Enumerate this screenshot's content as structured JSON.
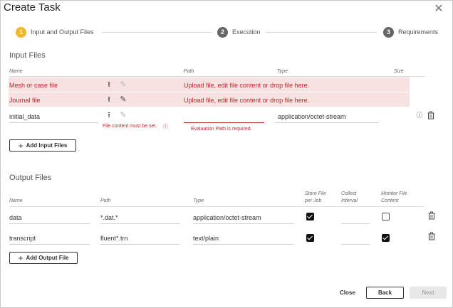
{
  "dialog": {
    "title": "Create Task"
  },
  "steps": [
    {
      "number": "1",
      "label": "Input and Output Files",
      "color": "#f5b52a"
    },
    {
      "number": "2",
      "label": "Execution",
      "color": "#666666"
    },
    {
      "number": "3",
      "label": "Requirements",
      "color": "#666666"
    }
  ],
  "input_files": {
    "section_title": "Input Files",
    "columns": {
      "name": "Name",
      "path": "Path",
      "type": "Type",
      "size": "Size"
    },
    "rows": [
      {
        "name": "Mesh or case file",
        "message": "Upload file, edit file content or drop file here."
      },
      {
        "name": "Journal file",
        "message": "Upload file, edit file content or drop file here."
      },
      {
        "name": "initial_data",
        "path_value": "",
        "type_value": "application/octet-stream",
        "content_error": "File content must be set.",
        "path_error": "Evaluation Path is required."
      }
    ],
    "add_button": "Add Input Files"
  },
  "output_files": {
    "section_title": "Output Files",
    "columns": {
      "name": "Name",
      "path": "Path",
      "type": "Type",
      "store_line1": "Store File",
      "store_line2": "per Job",
      "collect_line1": "Collect",
      "collect_line2": "Interval",
      "monitor_line1": "Monitor File",
      "monitor_line2": "Content"
    },
    "rows": [
      {
        "name": "data",
        "path": "*.dat.*",
        "type": "application/octet-stream",
        "store": true,
        "monitor": false
      },
      {
        "name": "transcript",
        "path": "fluent*.trn",
        "type": "text/plain",
        "store": true,
        "monitor": true
      }
    ],
    "add_button": "Add Output File"
  },
  "footer": {
    "close": "Close",
    "back": "Back",
    "next": "Next"
  },
  "colors": {
    "error_red": "#c0272d",
    "error_bg": "#f7e1e1",
    "active_step": "#f5b52a"
  }
}
